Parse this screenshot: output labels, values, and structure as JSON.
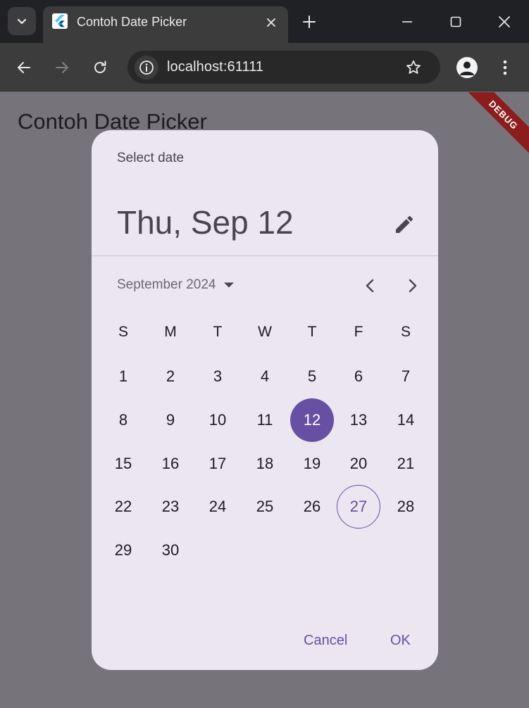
{
  "browser": {
    "tab_title": "Contoh Date Picker",
    "url": "localhost:61111"
  },
  "app": {
    "title": "Contoh Date Picker",
    "debug_banner": "DEBUG"
  },
  "date_picker": {
    "help_text": "Select date",
    "headline": "Thu, Sep 12",
    "month_label": "September 2024",
    "weekdays": [
      "S",
      "M",
      "T",
      "W",
      "T",
      "F",
      "S"
    ],
    "selected_day": 12,
    "today_day": 27,
    "weeks": [
      [
        "1",
        "2",
        "3",
        "4",
        "5",
        "6",
        "7"
      ],
      [
        "8",
        "9",
        "10",
        "11",
        "12",
        "13",
        "14"
      ],
      [
        "15",
        "16",
        "17",
        "18",
        "19",
        "20",
        "21"
      ],
      [
        "22",
        "23",
        "24",
        "25",
        "26",
        "27",
        "28"
      ],
      [
        "29",
        "30"
      ]
    ],
    "cancel_label": "Cancel",
    "ok_label": "OK"
  },
  "colors": {
    "primary": "#6750a4",
    "dialog_bg": "#ece6f0",
    "scrim": "#77737a"
  }
}
